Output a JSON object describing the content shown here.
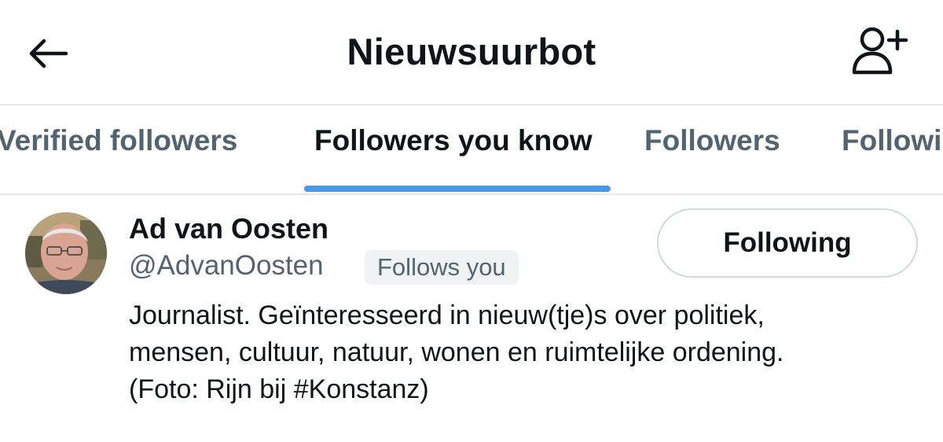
{
  "header": {
    "title": "Nieuwsuurbot",
    "back_icon": "arrow-left-icon",
    "add_user_icon": "person-plus-icon"
  },
  "tabs": [
    {
      "label": "Verified followers",
      "active": false
    },
    {
      "label": "Followers you know",
      "active": true
    },
    {
      "label": "Followers",
      "active": false
    },
    {
      "label": "Followi",
      "active": false
    }
  ],
  "colors": {
    "accent": "#4a99e9",
    "text_primary": "#0f1419",
    "text_secondary": "#536471",
    "divider": "#e6e9eb",
    "badge_bg": "#eff3f4",
    "button_border": "#cfd9de"
  },
  "users": [
    {
      "display_name": "Ad van Oosten",
      "handle": "@AdvanOosten",
      "badge": "Follows you",
      "button_label": "Following",
      "bio_lines": [
        "Journalist. Geïnteresseerd in nieuw(tje)s over politiek,",
        "mensen, cultuur, natuur, wonen en ruimtelijke ordening.",
        "(Foto: Rijn bij #Konstanz)"
      ]
    }
  ]
}
